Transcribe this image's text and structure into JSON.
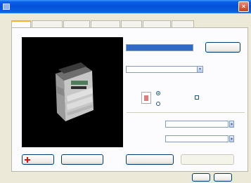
{
  "window": {
    "title": ""
  },
  "tabs": [],
  "preview": {
    "caption": ""
  },
  "fields": {
    "paper_size": {
      "label": "",
      "value": ""
    },
    "paper_source": {
      "label": "",
      "value": ""
    },
    "orientation": {
      "label": "",
      "portrait": "",
      "landscape": "",
      "rotated": ""
    },
    "field_a": {
      "label": "",
      "value": ""
    },
    "field_b": {
      "label": "",
      "value": ""
    }
  },
  "buttons": {
    "top_right": "",
    "b1": "",
    "b2": "",
    "b3": "",
    "b4": "",
    "ok": "",
    "cancel": ""
  },
  "colors": {
    "titlebar": "#0451d8",
    "accent_select": "#316ac5",
    "dialog_bg": "#ece9d8",
    "tab_highlight": "#f4b038"
  }
}
